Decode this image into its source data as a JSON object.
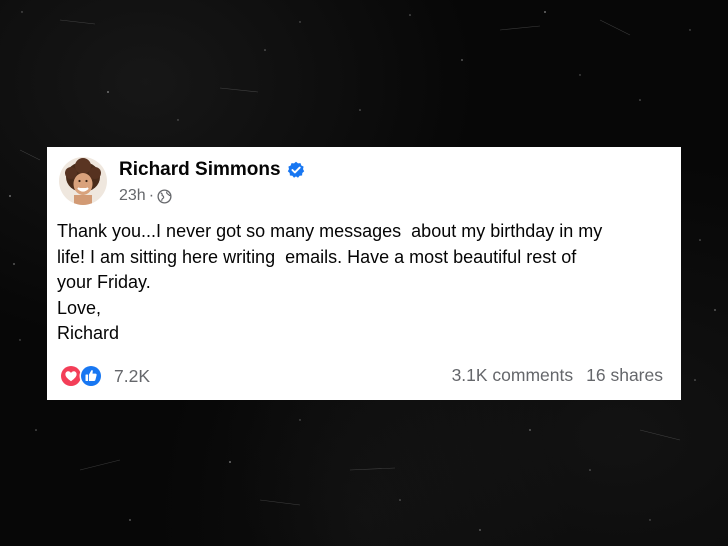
{
  "colors": {
    "background": "#050505",
    "card": "#ffffff",
    "text_primary": "#050505",
    "text_secondary": "#65676b",
    "verified_blue": "#1877f2",
    "love_red": "#f33e58",
    "like_blue": "#1877f2"
  },
  "post": {
    "author_name": "Richard Simmons",
    "verified_icon": "verified-badge-icon",
    "timestamp": "23h",
    "separator": "·",
    "audience_icon": "globe-icon",
    "body_lines": [
      "Thank you...I never got so many messages  about my birthday in my",
      "life! I am sitting here writing  emails. Have a most beautiful rest of",
      "your Friday.",
      "Love,",
      "Richard"
    ],
    "reaction_icons": [
      "love-reaction-icon",
      "like-reaction-icon"
    ],
    "reaction_count": "7.2K",
    "comments": "3.1K comments",
    "shares": "16 shares"
  }
}
